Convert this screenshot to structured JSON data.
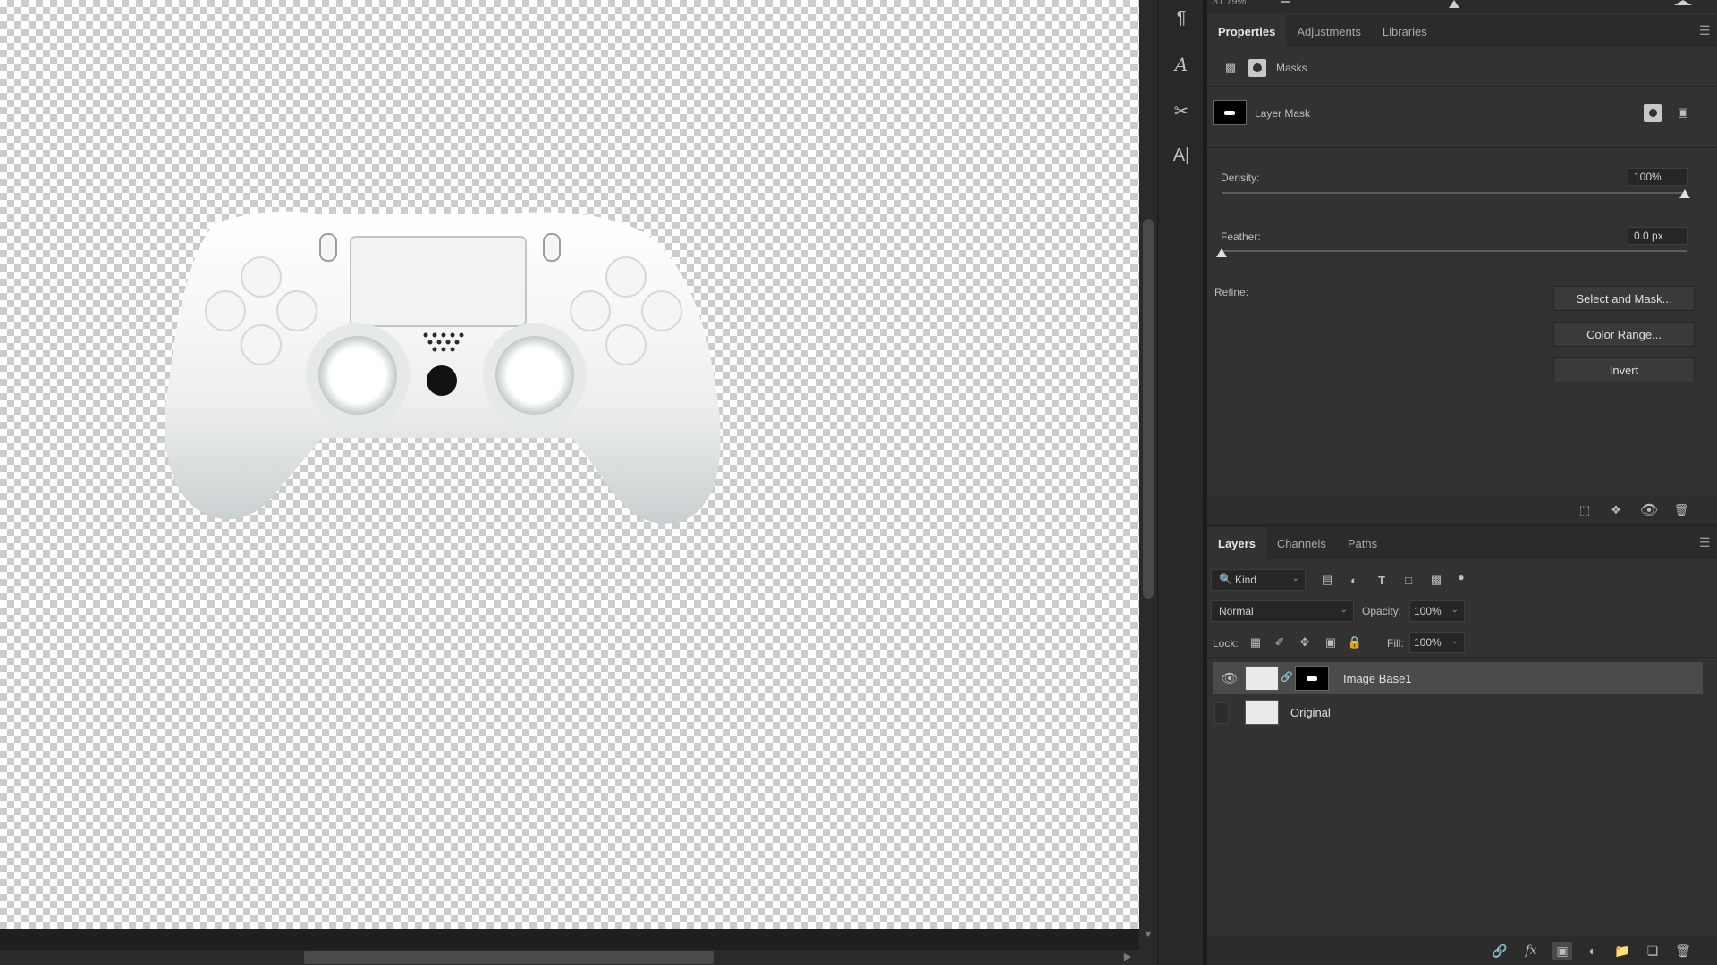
{
  "canvas": {
    "zoom_readout": "31.79%",
    "subject": "white game controller on transparent background"
  },
  "toolstrip": {
    "icons": [
      "paragraph-icon",
      "character-style-icon",
      "tool-presets-icon",
      "glyphs-icon"
    ]
  },
  "properties_panel": {
    "tabs": [
      "Properties",
      "Adjustments",
      "Libraries"
    ],
    "active_tab": "Properties",
    "section_title": "Masks",
    "mask_label": "Layer Mask",
    "density_label": "Density:",
    "density_value": "100%",
    "density_level": 1.0,
    "feather_label": "Feather:",
    "feather_value": "0.0 px",
    "feather_level": 0.0,
    "refine_label": "Refine:",
    "buttons": {
      "select_and_mask": "Select and Mask...",
      "color_range": "Color Range...",
      "invert": "Invert"
    }
  },
  "layers_panel": {
    "tabs": [
      "Layers",
      "Channels",
      "Paths"
    ],
    "active_tab": "Layers",
    "filter_kind": "Kind",
    "blend_mode": "Normal",
    "opacity_label": "Opacity:",
    "opacity_value": "100%",
    "lock_label": "Lock:",
    "fill_label": "Fill:",
    "fill_value": "100%",
    "layers": [
      {
        "name": "Image Base1",
        "visible": true,
        "selected": true,
        "has_mask": true
      },
      {
        "name": "Original",
        "visible": false,
        "selected": false,
        "has_mask": false
      }
    ]
  },
  "colors": {
    "panel_bg": "#323232",
    "selected_layer": "#4b4b4b",
    "text": "#c8c8c8"
  }
}
